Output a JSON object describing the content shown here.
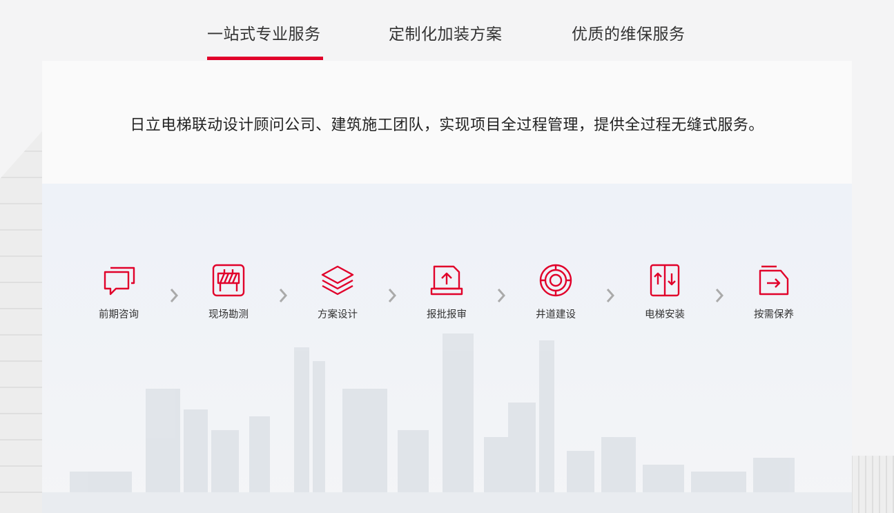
{
  "tabs": [
    {
      "label": "一站式专业服务",
      "active": true
    },
    {
      "label": "定制化加装方案",
      "active": false
    },
    {
      "label": "优质的维保服务",
      "active": false
    }
  ],
  "intro_text": "日立电梯联动设计顾问公司、建筑施工团队，实现项目全过程管理，提供全过程无缝式服务。",
  "steps": [
    {
      "label": "前期咨询",
      "icon": "chat-bubble-icon"
    },
    {
      "label": "现场勘测",
      "icon": "survey-board-icon"
    },
    {
      "label": "方案设计",
      "icon": "layers-icon"
    },
    {
      "label": "报批报审",
      "icon": "upload-folder-icon"
    },
    {
      "label": "井道建设",
      "icon": "target-shaft-icon"
    },
    {
      "label": "电梯安装",
      "icon": "elevator-doors-icon"
    },
    {
      "label": "按需保养",
      "icon": "arrow-folder-icon"
    }
  ],
  "colors": {
    "accent": "#e1002a",
    "text": "#333333",
    "arrow": "#aaaaaa"
  }
}
